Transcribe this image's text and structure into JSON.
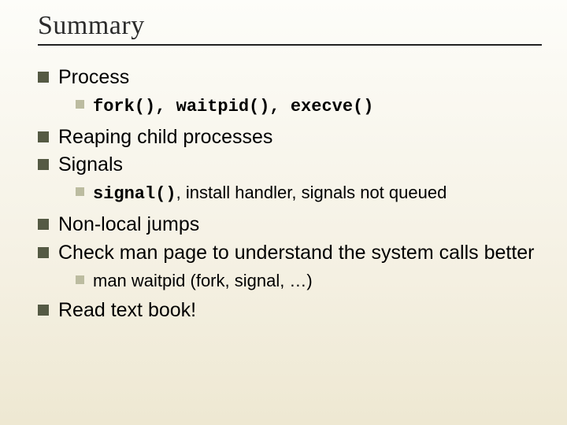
{
  "title": "Summary",
  "items": [
    {
      "text": "Process",
      "children": [
        {
          "html": "<span class=\"mono\">fork(), waitpid(), execve()</span>"
        }
      ]
    },
    {
      "text": "Reaping child processes"
    },
    {
      "text": "Signals",
      "children": [
        {
          "html": "<span class=\"mono\">signal()</span>, install handler, signals not queued"
        }
      ]
    },
    {
      "text": "Non-local jumps"
    },
    {
      "text": "Check man page to understand the system calls better",
      "children": [
        {
          "text": "man waitpid (fork, signal, …)"
        }
      ]
    },
    {
      "text": "Read text book!"
    }
  ]
}
